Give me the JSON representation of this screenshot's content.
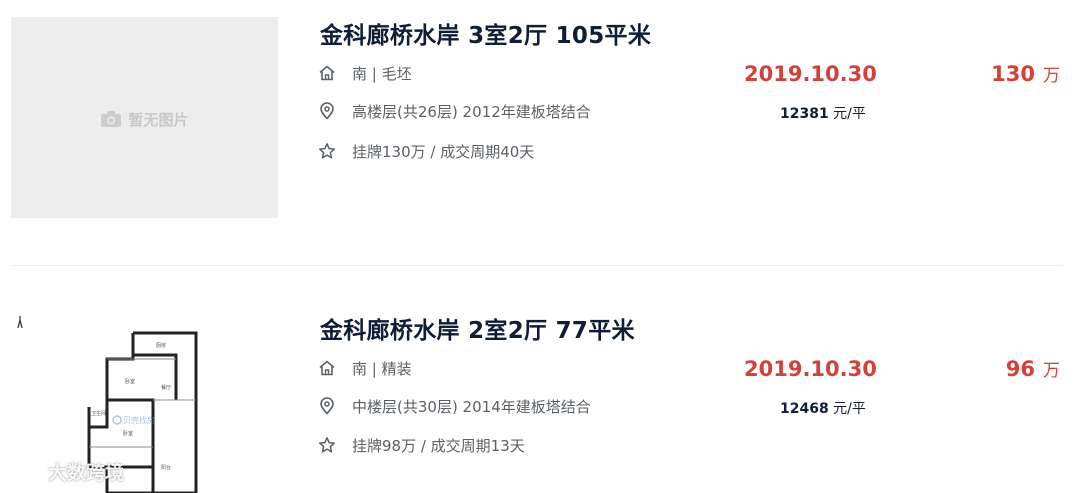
{
  "listings": [
    {
      "image_placeholder": "暂无图片",
      "title": "金科廊桥水岸 3室2厅 105平米",
      "orientation_decoration": "南 | 毛坯",
      "floor_info": "高楼层(共26层) 2012年建板塔结合",
      "deal_info": "挂牌130万 / 成交周期40天",
      "deal_date": "2019.10.30",
      "unit_price_value": "12381",
      "unit_price_unit": "元/平",
      "total_price_value": "130",
      "total_price_unit": "万"
    },
    {
      "title": "金科廊桥水岸 2室2厅 77平米",
      "orientation_decoration": "南 | 精装",
      "floor_info": "中楼层(共30层) 2014年建板塔结合",
      "deal_info": "挂牌98万 / 成交周期13天",
      "deal_date": "2019.10.30",
      "unit_price_value": "12468",
      "unit_price_unit": "元/平",
      "total_price_value": "96",
      "total_price_unit": "万",
      "floorplan_watermark": "贝壳找房"
    }
  ],
  "watermark": "大数跨境",
  "icons": {
    "orientation": "house-icon",
    "location": "location-pin-icon",
    "deal": "star-icon",
    "placeholder": "camera-icon"
  },
  "colors": {
    "price_red": "#d2423a",
    "title_navy": "#101d37",
    "meta_gray": "#5c6166"
  }
}
